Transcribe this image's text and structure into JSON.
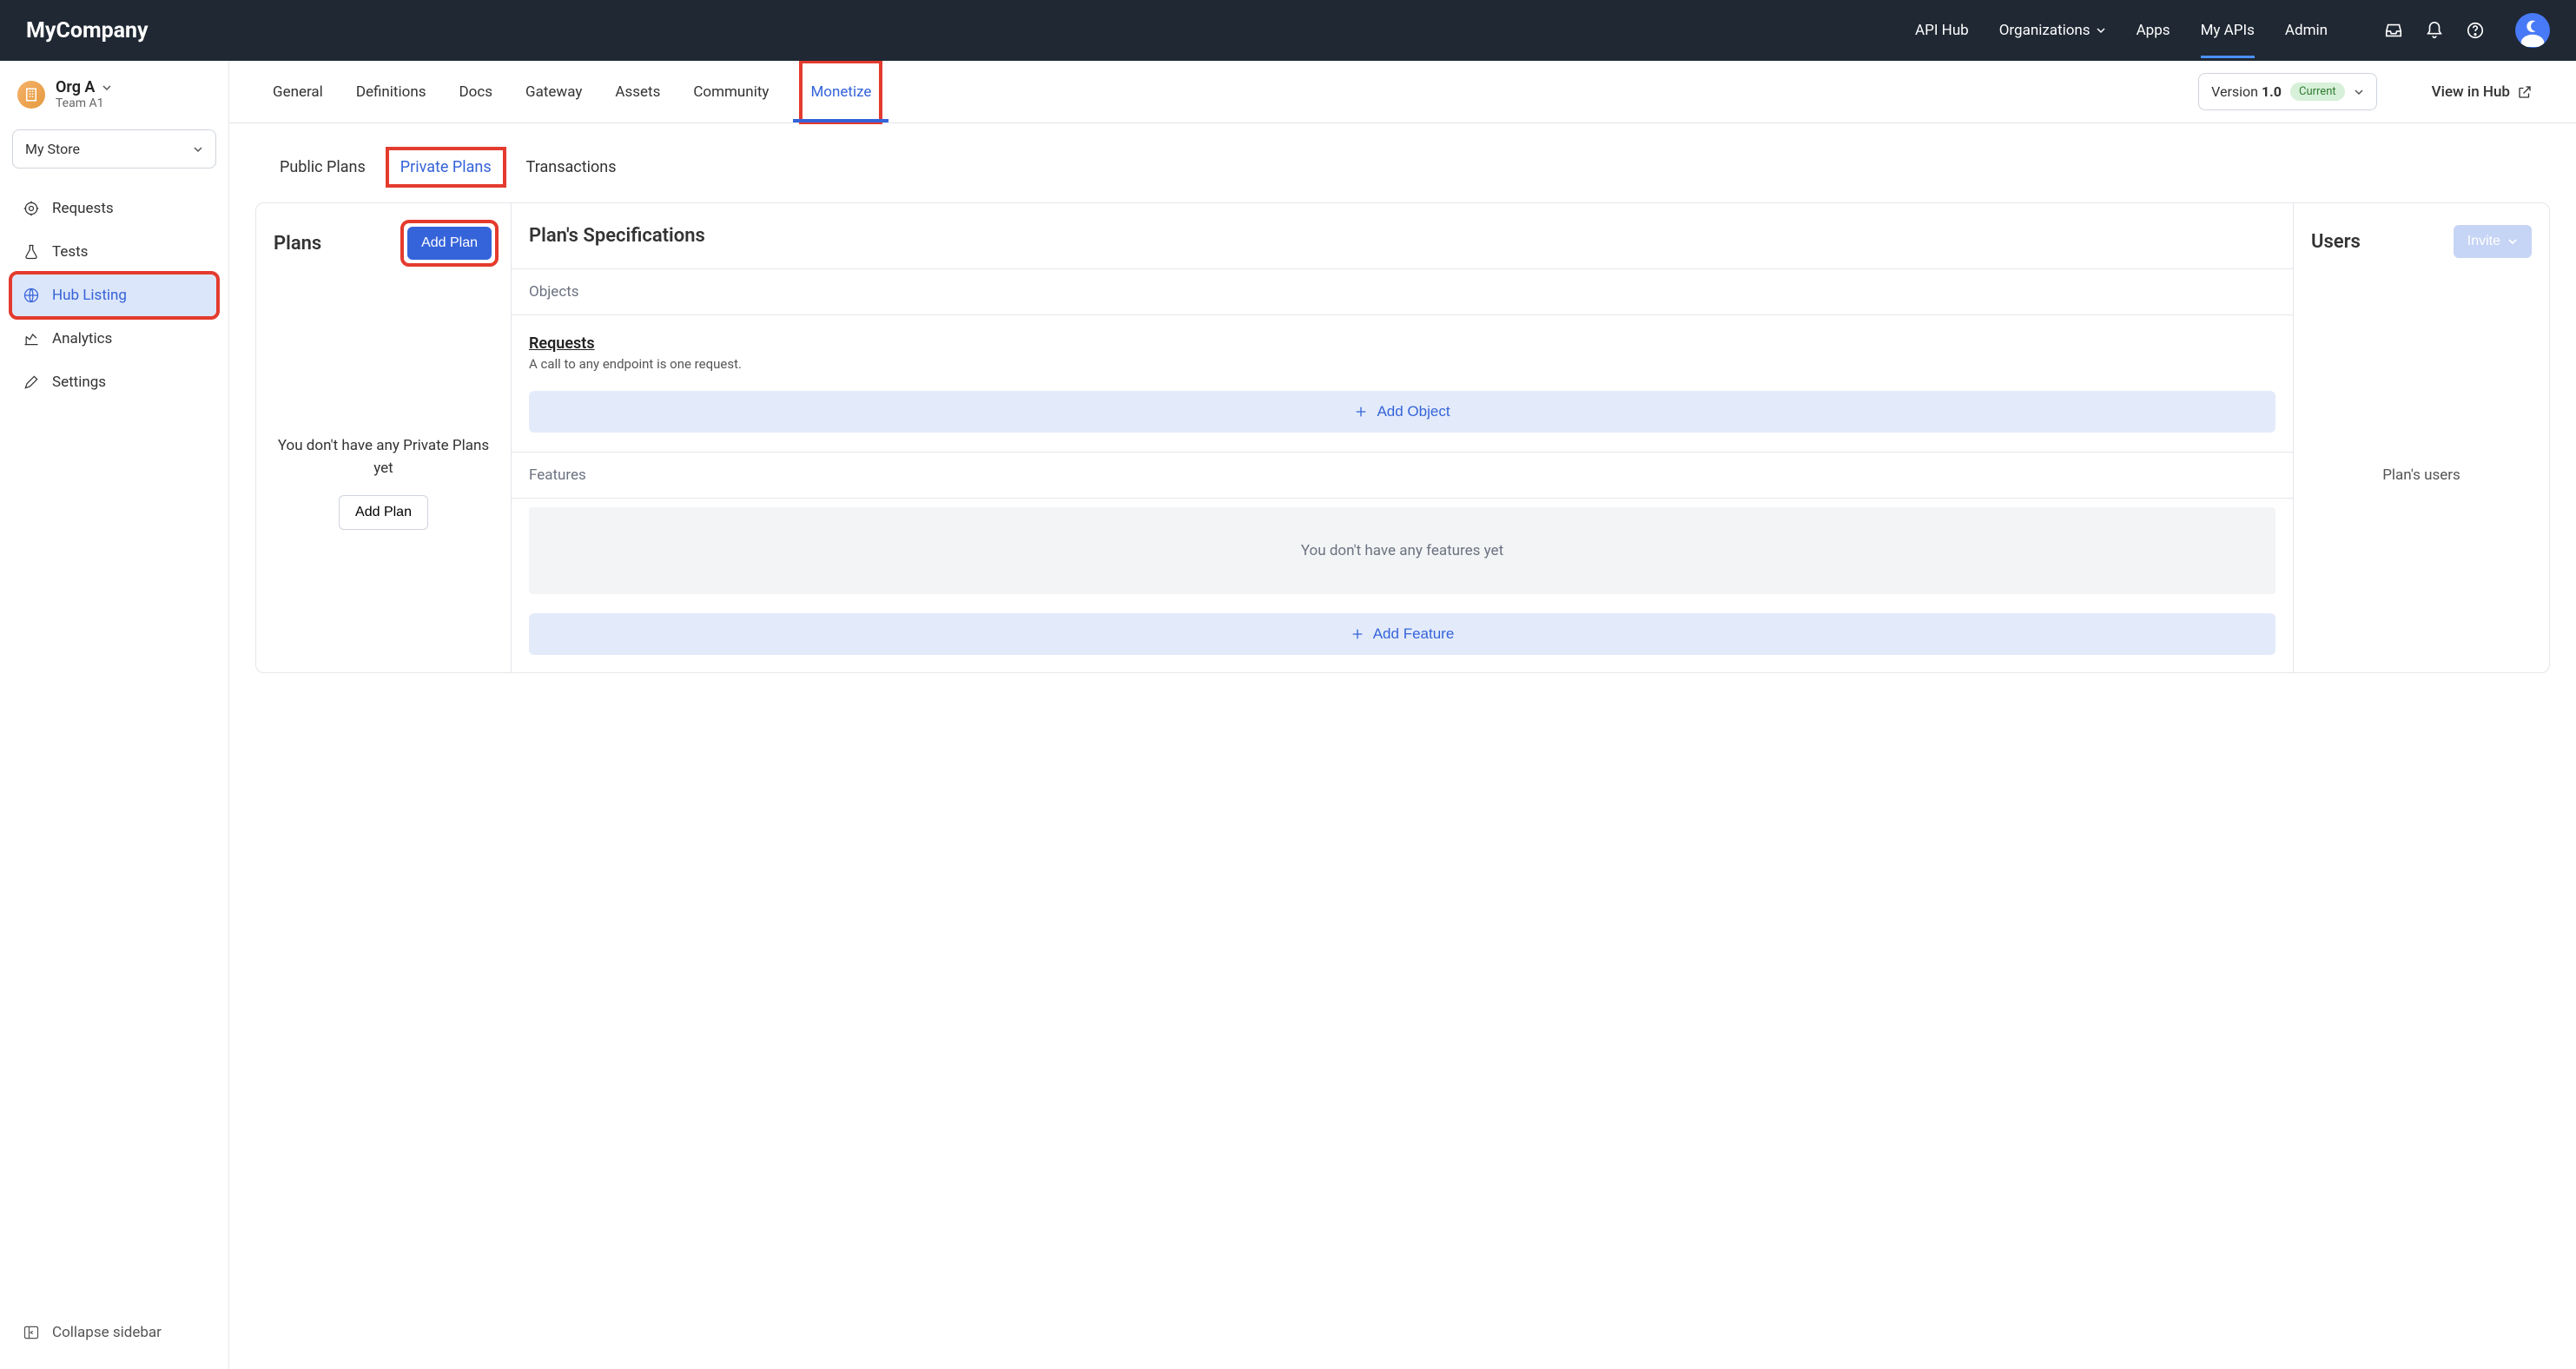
{
  "header": {
    "logo": "MyCompany",
    "nav": {
      "api_hub": "API Hub",
      "organizations": "Organizations",
      "apps": "Apps",
      "my_apis": "My APIs",
      "admin": "Admin"
    }
  },
  "sidebar": {
    "org_name": "Org A",
    "team_name": "Team A1",
    "store": "My Store",
    "items": {
      "requests": "Requests",
      "tests": "Tests",
      "hub_listing": "Hub Listing",
      "analytics": "Analytics",
      "settings": "Settings"
    },
    "collapse": "Collapse sidebar"
  },
  "top_tabs": {
    "general": "General",
    "definitions": "Definitions",
    "docs": "Docs",
    "gateway": "Gateway",
    "assets": "Assets",
    "community": "Community",
    "monetize": "Monetize",
    "version_label": "Version ",
    "version_value": "1.0",
    "current_badge": "Current",
    "view_in_hub": "View in Hub"
  },
  "sub_tabs": {
    "public": "Public Plans",
    "private": "Private Plans",
    "transactions": "Transactions"
  },
  "plans": {
    "title": "Plans",
    "add_btn": "Add Plan",
    "empty": "You don't have any Private Plans yet",
    "add_btn2": "Add Plan"
  },
  "spec": {
    "title": "Plan's Specifications",
    "objects_label": "Objects",
    "requests_title": "Requests",
    "requests_desc": "A call to any endpoint is one request.",
    "add_object": "Add Object",
    "features_label": "Features",
    "empty_features": "You don't have any features yet",
    "add_feature": "Add Feature"
  },
  "users": {
    "title": "Users",
    "invite": "Invite",
    "empty": "Plan's users"
  }
}
